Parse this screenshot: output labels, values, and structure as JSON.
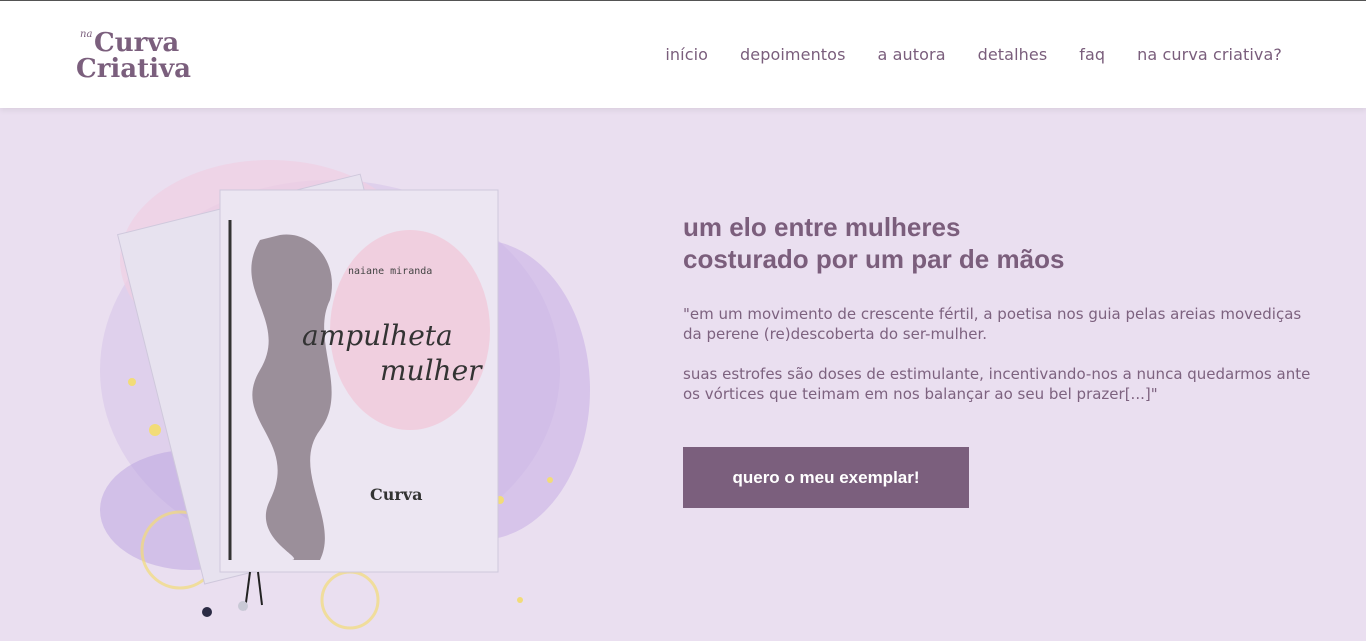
{
  "brand": {
    "logo_small_word": "na",
    "logo_word_1": "Curva",
    "logo_word_2": "Criativa",
    "primary_color": "#7b5f7d",
    "background_color": "#eadff0"
  },
  "nav": {
    "items": [
      {
        "label": "início"
      },
      {
        "label": "depoimentos"
      },
      {
        "label": "a autora"
      },
      {
        "label": "detalhes"
      },
      {
        "label": "faq"
      },
      {
        "label": "na curva criativa?"
      }
    ]
  },
  "hero": {
    "headline_line1": "um elo entre mulheres",
    "headline_line2": "costurado por um par de mãos",
    "quote_p1": "\"em um movimento de crescente fértil, a poetisa nos guia pelas areias movediças da perene (re)descoberta do ser-mulher.",
    "quote_p2": "suas estrofes são doses de estimulante, incentivando-nos a nunca quedarmos ante os vórtices que teimam em nos balançar ao seu bel prazer[...]\"",
    "cta_label": "quero o meu exemplar!"
  },
  "book": {
    "author": "naiane miranda",
    "title_line1": "ampulheta",
    "title_line2": "mulher"
  }
}
